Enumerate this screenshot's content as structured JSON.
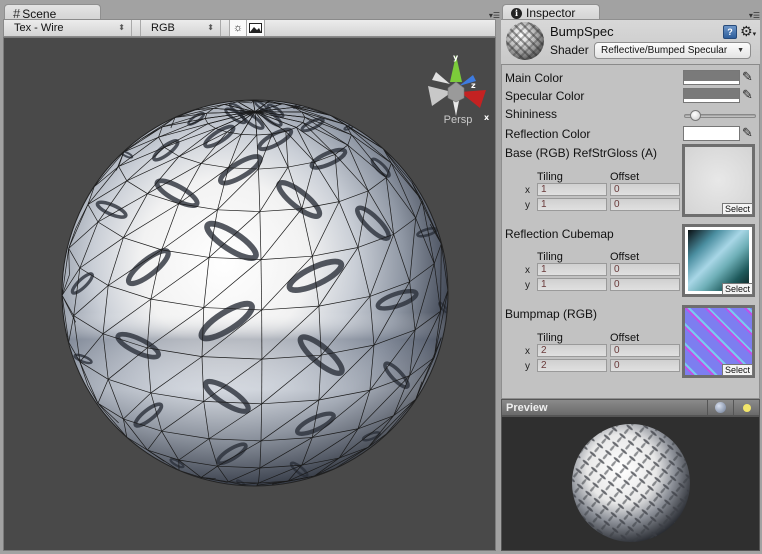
{
  "scene": {
    "tab_label": "Scene",
    "tab_icon": "grid-icon",
    "render_mode": "Tex - Wire",
    "color_channel": "RGB",
    "lighting_toggle_icon": "sun-icon",
    "fx_toggle_icon": "image-icon",
    "gizmo": {
      "axes": [
        "y",
        "z",
        "x"
      ],
      "projection": "Persp"
    }
  },
  "inspector": {
    "tab_label": "Inspector",
    "tab_icon": "info-icon",
    "material_name": "BumpSpec",
    "shader_label": "Shader",
    "shader_value": "Reflective/Bumped Specular",
    "properties": {
      "main_color": {
        "label": "Main Color",
        "color": "#7a7a7a"
      },
      "specular_color": {
        "label": "Specular Color",
        "color": "#7a7a7a"
      },
      "shininess": {
        "label": "Shininess",
        "value_fraction": 0.1
      },
      "reflection_color": {
        "label": "Reflection Color",
        "color": "#ffffff"
      }
    },
    "textures": [
      {
        "label": "Base (RGB) RefStrGloss (A)",
        "tiling_label": "Tiling",
        "offset_label": "Offset",
        "tiling_x": "1",
        "tiling_y": "1",
        "offset_x": "0",
        "offset_y": "0",
        "select_label": "Select",
        "thumb": "base-texture"
      },
      {
        "label": "Reflection Cubemap",
        "tiling_label": "Tiling",
        "offset_label": "Offset",
        "tiling_x": "1",
        "tiling_y": "1",
        "offset_x": "0",
        "offset_y": "0",
        "select_label": "Select",
        "thumb": "cubemap-texture"
      },
      {
        "label": "Bumpmap (RGB)",
        "tiling_label": "Tiling",
        "offset_label": "Offset",
        "tiling_x": "2",
        "tiling_y": "2",
        "offset_x": "0",
        "offset_y": "0",
        "select_label": "Select",
        "thumb": "bumpmap-texture"
      }
    ],
    "axis_x": "x",
    "axis_y": "y"
  },
  "preview": {
    "title": "Preview"
  }
}
